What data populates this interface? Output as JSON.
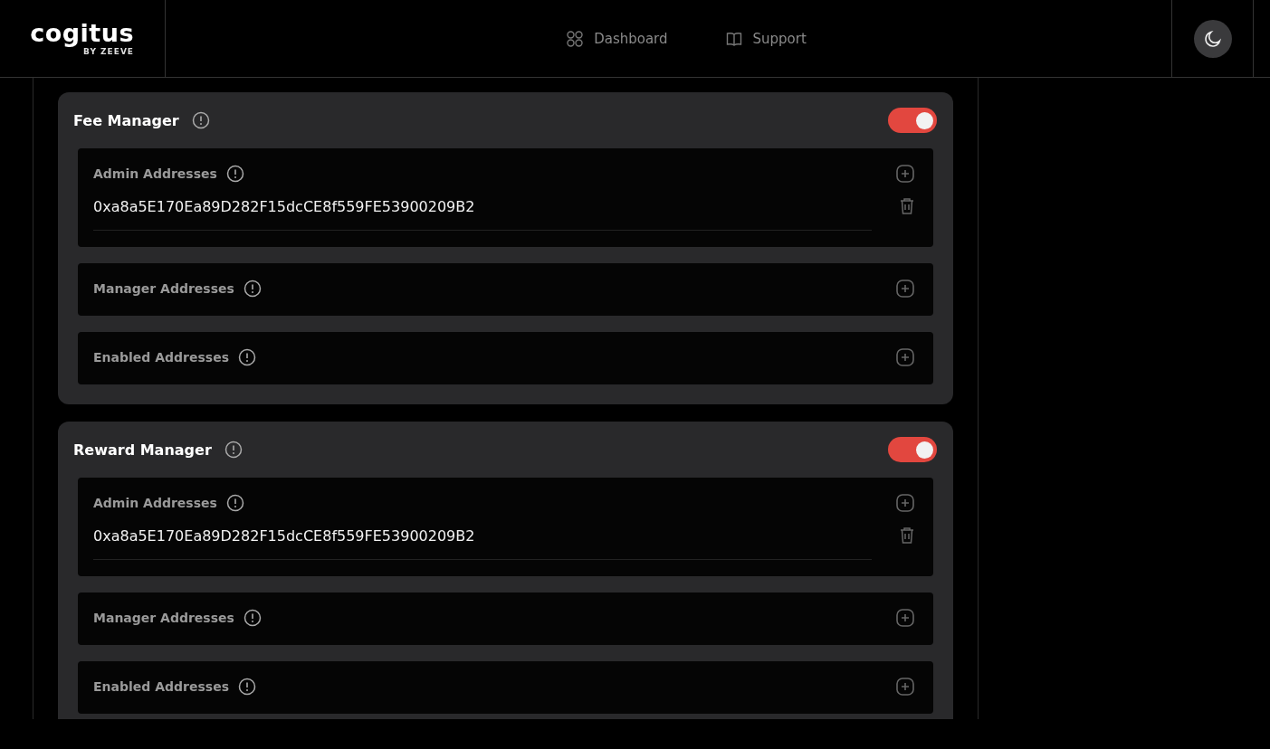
{
  "header": {
    "logo": "cogitus",
    "logo_sub": "BY ZEEVE",
    "nav": [
      {
        "label": "Dashboard",
        "kind": "grid"
      },
      {
        "label": "Support",
        "kind": "book"
      }
    ]
  },
  "managers": [
    {
      "title": "Fee Manager",
      "on": true,
      "sections": [
        {
          "label": "Admin Addresses",
          "addresses": [
            "0xa8a5E170Ea89D282F15dcCE8f559FE53900209B2"
          ]
        },
        {
          "label": "Manager Addresses"
        },
        {
          "label": "Enabled Addresses"
        }
      ]
    },
    {
      "title": "Reward Manager",
      "on": true,
      "sections": [
        {
          "label": "Admin Addresses",
          "addresses": [
            "0xa8a5E170Ea89D282F15dcCE8f559FE53900209B2"
          ]
        },
        {
          "label": "Manager Addresses"
        },
        {
          "label": "Enabled Addresses"
        }
      ]
    }
  ]
}
